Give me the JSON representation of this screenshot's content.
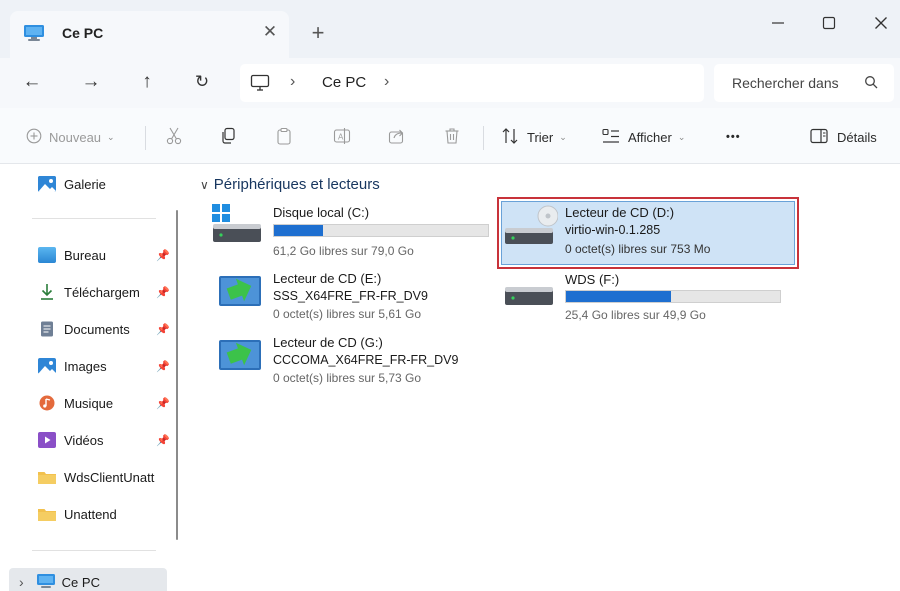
{
  "window": {
    "tab_title": "Ce PC",
    "new_tab": "+",
    "close_tab": "✕",
    "minimize": "—",
    "maximize": "☐",
    "close": "✕"
  },
  "nav": {
    "back": "←",
    "forward": "→",
    "up": "↑",
    "refresh": "↻",
    "breadcrumb_sep": "›",
    "breadcrumb": "Ce PC",
    "search_placeholder": "Rechercher dans"
  },
  "commands": {
    "new": "Nouveau",
    "sort": "Trier",
    "view": "Afficher",
    "more": "•••",
    "details": "Détails"
  },
  "sidebar": {
    "items": [
      {
        "label": "Galerie",
        "pinned": false
      },
      {
        "label": "Bureau",
        "pinned": true
      },
      {
        "label": "Téléchargem",
        "pinned": true
      },
      {
        "label": "Documents",
        "pinned": true
      },
      {
        "label": "Images",
        "pinned": true
      },
      {
        "label": "Musique",
        "pinned": true
      },
      {
        "label": "Vidéos",
        "pinned": true
      },
      {
        "label": "WdsClientUnatt",
        "pinned": false
      },
      {
        "label": "Unattend",
        "pinned": false
      }
    ],
    "this_pc": "Ce PC",
    "expand": "›",
    "pin_glyph": "📌"
  },
  "content": {
    "section_title": "Périphériques et lecteurs",
    "section_chevron": "∨",
    "drives": [
      {
        "name": "Disque local (C:)",
        "free": "61,2 Go libres sur 79,0 Go",
        "used_fraction": 0.23
      },
      {
        "name": "Lecteur de CD (D:)",
        "label": "virtio-win-0.1.285",
        "free": "0 octet(s) libres sur 753 Mo",
        "selected": true
      },
      {
        "name": "Lecteur de CD (E:)",
        "label": "SSS_X64FRE_FR-FR_DV9",
        "free": "0 octet(s) libres sur 5,61 Go"
      },
      {
        "name": "WDS (F:)",
        "free": "25,4 Go libres sur 49,9 Go",
        "used_fraction": 0.49
      },
      {
        "name": "Lecteur de CD (G:)",
        "label": "CCCOMA_X64FRE_FR-FR_DV9",
        "free": "0 octet(s) libres sur 5,73 Go"
      }
    ]
  },
  "colors": {
    "accent": "#1e6fd0",
    "selection": "#cfe3f6",
    "highlight_border": "#c8323a",
    "folder": "#f2c14e"
  }
}
